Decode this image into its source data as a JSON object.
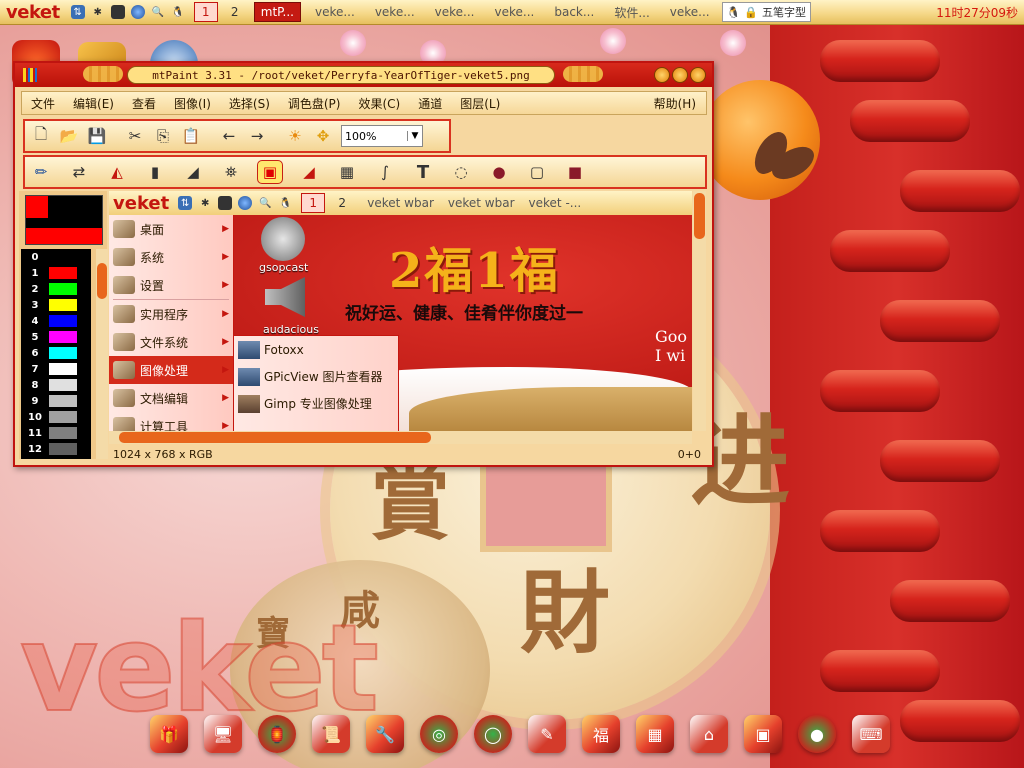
{
  "taskbar": {
    "brand": "veket",
    "workspaces": [
      "1",
      "2"
    ],
    "tasks": [
      "mtP...",
      "veke...",
      "veke...",
      "veke...",
      "veke...",
      "back...",
      "软件...",
      "veke..."
    ],
    "ime_label": "五笔字型",
    "clock": "11时27分09秒"
  },
  "mtpaint": {
    "title": "mtPaint 3.31 - /root/veket/Perryfa-YearOfTiger-veket5.png",
    "menu": [
      "文件",
      "编辑(E)",
      "查看",
      "图像(I)",
      "选择(S)",
      "调色盘(P)",
      "效果(C)",
      "通道",
      "图层(L)"
    ],
    "help": "帮助(H)",
    "zoom": "100%",
    "palette": [
      {
        "n": "0",
        "c": "#000000"
      },
      {
        "n": "1",
        "c": "#ff0000"
      },
      {
        "n": "2",
        "c": "#00ff00"
      },
      {
        "n": "3",
        "c": "#ffff00"
      },
      {
        "n": "4",
        "c": "#0000ff"
      },
      {
        "n": "5",
        "c": "#ff00ff"
      },
      {
        "n": "6",
        "c": "#00ffff"
      },
      {
        "n": "7",
        "c": "#ffffff"
      },
      {
        "n": "8",
        "c": "#e0e0e0"
      },
      {
        "n": "9",
        "c": "#c0c0c0"
      },
      {
        "n": "10",
        "c": "#a0a0a0"
      },
      {
        "n": "11",
        "c": "#808080"
      },
      {
        "n": "12",
        "c": "#606060"
      }
    ],
    "status_left": "1024 x 768 x RGB",
    "status_right": "0+0"
  },
  "inner": {
    "brand": "veket",
    "workspaces": [
      "1",
      "2"
    ],
    "tasks": [
      "veket wbar",
      "veket wbar",
      "veket -..."
    ],
    "menu": [
      {
        "label": "桌面"
      },
      {
        "label": "系统"
      },
      {
        "label": "设置"
      },
      {
        "label": "实用程序"
      },
      {
        "label": "文件系统"
      },
      {
        "label": "图像处理"
      },
      {
        "label": "文档编辑"
      },
      {
        "label": "计算工具"
      }
    ],
    "submenu": [
      "Fotoxx",
      "GPicView 图片查看器",
      "Gimp 专业图像处理"
    ],
    "desk_icons": [
      "gsopcast",
      "audacious"
    ],
    "banner": "2福1福",
    "banner_sub": "祝好运、健康、佳肴伴你度过一",
    "banner_en": "Goo\nI wi"
  },
  "wallpaper": {
    "watermark": "veket",
    "coin_chars": [
      "进",
      "財",
      "賞",
      "咸",
      "寶"
    ]
  },
  "colors": {
    "accent": "#c4160f",
    "panel": "#f6d98a",
    "scroll_thumb": "#e8661c"
  }
}
